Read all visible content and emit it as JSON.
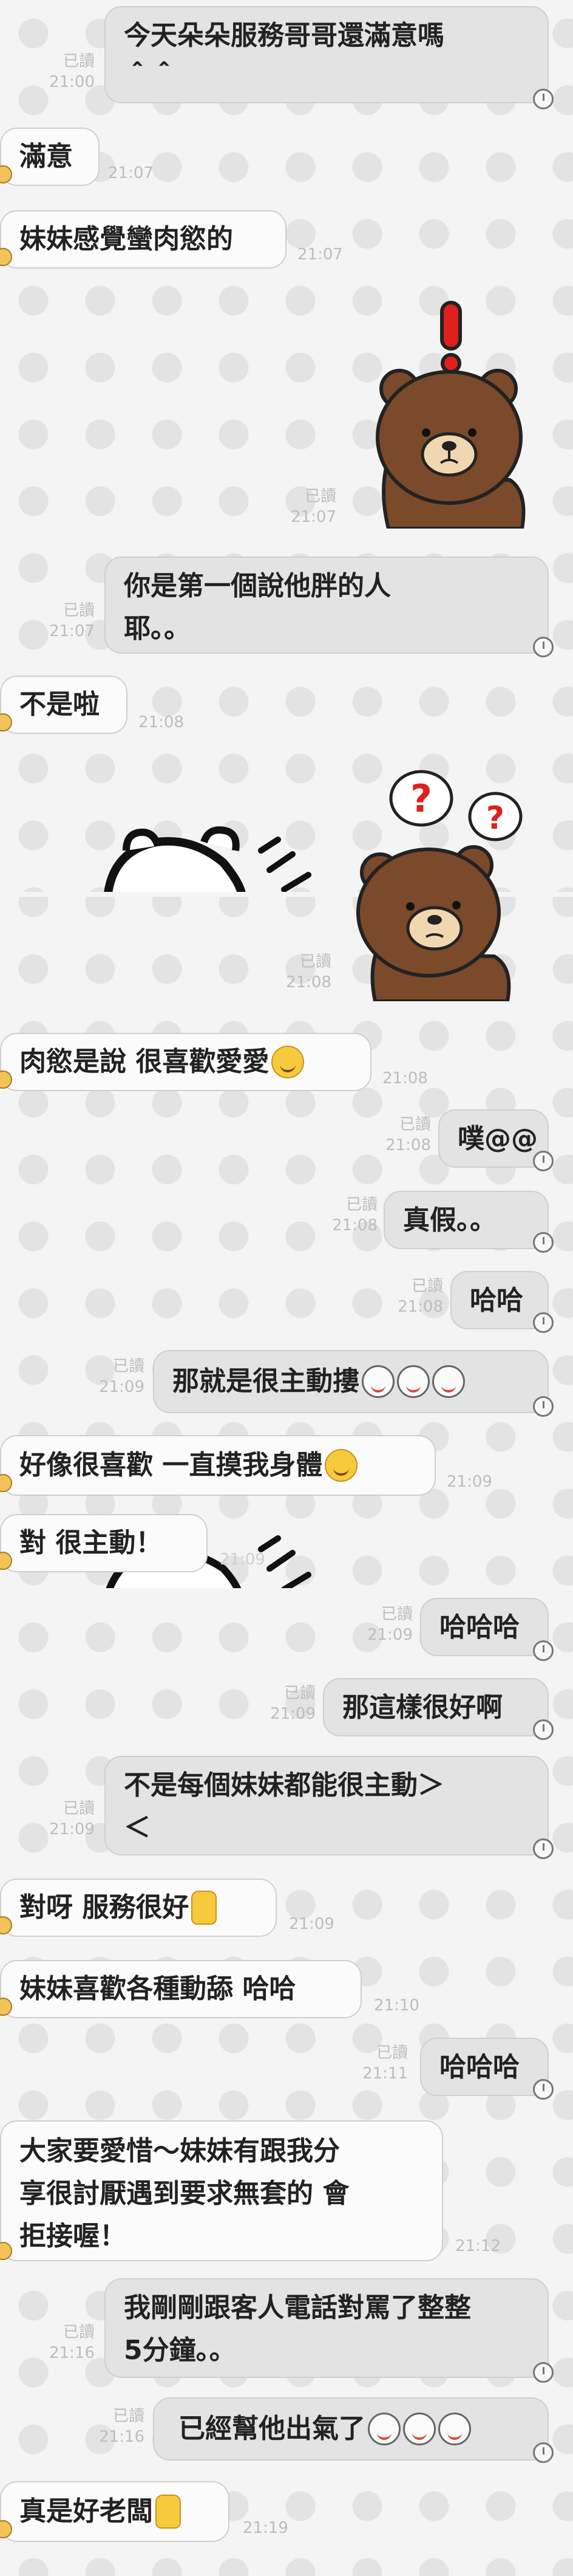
{
  "messages": [
    {
      "dir": "out",
      "text": "今天朵朵服務哥哥還滿意嗎\n＾＾",
      "read": "已讀",
      "time": "21:00"
    },
    {
      "dir": "in",
      "text": "滿意",
      "time": "21:07"
    },
    {
      "dir": "in",
      "text": "妹妹感覺蠻肉慾的",
      "time": "21:07"
    },
    {
      "dir": "sticker",
      "sticker": "brown-bear-exclamation",
      "read": "已讀",
      "time": "21:07"
    },
    {
      "dir": "out",
      "text": "你是第一個說他胖的人\n耶。。",
      "read": "已讀",
      "time": "21:07"
    },
    {
      "dir": "in",
      "text": "不是啦",
      "time": "21:08"
    },
    {
      "dir": "in-sticker",
      "sticker": "white-bear-peeking",
      "time": ""
    },
    {
      "dir": "sticker",
      "sticker": "brown-bear-question",
      "read": "已讀",
      "time": "21:08"
    },
    {
      "dir": "in",
      "text": "肉慾是說 很喜歡愛愛",
      "emoji": "grin",
      "time": "21:08"
    },
    {
      "dir": "out",
      "text": "噗@@",
      "read": "已讀",
      "time": "21:08"
    },
    {
      "dir": "out",
      "text": "真假。。",
      "read": "已讀",
      "time": "21:08"
    },
    {
      "dir": "out",
      "text": "哈哈",
      "read": "已讀",
      "time": "21:08"
    },
    {
      "dir": "out",
      "text": "那就是很主動摟",
      "emoji": "cry",
      "read": "已讀",
      "time": "21:09"
    },
    {
      "dir": "in",
      "text": "好像很喜歡 一直摸我身體",
      "emoji": "grin",
      "time": "21:09"
    },
    {
      "dir": "in",
      "text": "對 很主動！",
      "time": "21:09"
    },
    {
      "dir": "out",
      "text": "哈哈哈",
      "read": "已讀",
      "time": "21:09"
    },
    {
      "dir": "out",
      "text": "那這樣很好啊",
      "read": "已讀",
      "time": "21:09"
    },
    {
      "dir": "out",
      "text": "不是每個妹妹都能很主動＞\n＜",
      "read": "已讀",
      "time": "21:09"
    },
    {
      "dir": "in",
      "text": "對呀 服務很好",
      "emoji": "thumb",
      "time": "21:09"
    },
    {
      "dir": "in",
      "text": "妹妹喜歡各種動舔 哈哈",
      "time": "21:10"
    },
    {
      "dir": "out",
      "text": "哈哈哈",
      "read": "已讀",
      "time": "21:11"
    },
    {
      "dir": "in",
      "text": "大家要愛惜～妹妹有跟我分\n享很討厭遇到要求無套的 會\n拒接喔！",
      "time": "21:12"
    },
    {
      "dir": "out",
      "text": "我剛剛跟客人電話對罵了整整\n5分鐘。。",
      "read": "已讀",
      "time": "21:16"
    },
    {
      "dir": "out",
      "text": "已經幫他出氣了",
      "emoji": "cry",
      "read": "已讀",
      "time": "21:16"
    },
    {
      "dir": "in",
      "text": "真是好老闆",
      "emoji": "thumb",
      "time": "21:19"
    }
  ]
}
